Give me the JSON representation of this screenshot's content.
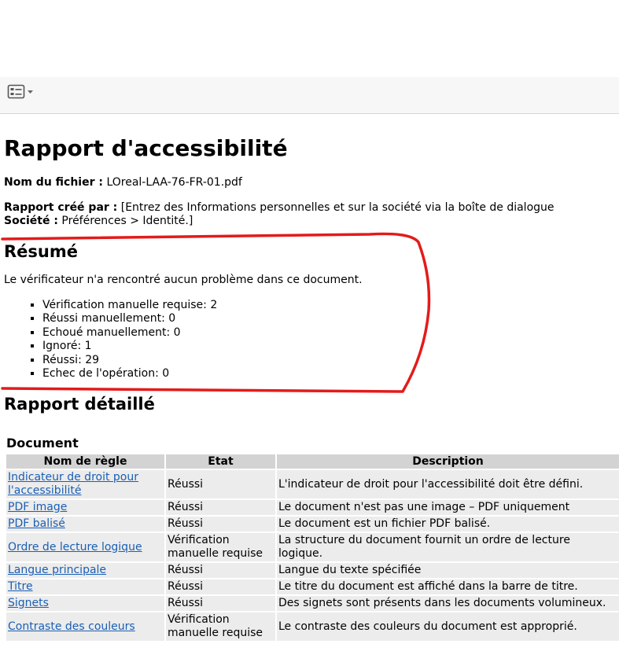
{
  "page": {
    "title": "Rapport d'accessibilité",
    "file_label": "Nom du fichier :",
    "file_value": "LOreal-LAA-76-FR-01.pdf",
    "created_label": "Rapport créé par :",
    "created_value": "[Entrez des Informations personnelles et sur la société via la boîte de dialogue",
    "company_label": "Société :",
    "company_value": "Préférences > Identité.]"
  },
  "summary": {
    "heading": "Résumé",
    "text": "Le vérificateur n'a rencontré aucun problème dans ce document.",
    "items": [
      "Vérification manuelle requise: 2",
      "Réussi manuellement: 0",
      "Echoué manuellement: 0",
      "Ignoré: 1",
      "Réussi: 29",
      "Echec de l'opération: 0"
    ]
  },
  "detail": {
    "heading": "Rapport détaillé",
    "section": "Document",
    "columns": [
      "Nom de règle",
      "Etat",
      "Description"
    ],
    "rows": [
      [
        "Indicateur de droit pour l'accessibilité",
        "Réussi",
        "L'indicateur de droit pour l'accessibilité doit être défini."
      ],
      [
        "PDF image",
        "Réussi",
        "Le document n'est pas une image – PDF uniquement"
      ],
      [
        "PDF balisé",
        "Réussi",
        "Le document est un fichier PDF balisé."
      ],
      [
        "Ordre de lecture logique",
        "Vérification manuelle requise",
        "La structure du document fournit un ordre de lecture logique."
      ],
      [
        "Langue principale",
        "Réussi",
        "Langue du texte spécifiée"
      ],
      [
        "Titre",
        "Réussi",
        "Le titre du document est affiché dans la barre de titre."
      ],
      [
        "Signets",
        "Réussi",
        "Des signets sont présents dans les documents volumineux."
      ],
      [
        "Contraste des couleurs",
        "Vérification manuelle requise",
        "Le contraste des couleurs du document est approprié."
      ]
    ]
  },
  "colors": {
    "annotation": "#e31b1b",
    "link": "#1a5fb4",
    "header_bg": "#d3d3d3",
    "cell_bg": "#ececec"
  },
  "icons": {
    "toolbar": "list-view-icon",
    "dropdown": "chevron-down-icon"
  }
}
